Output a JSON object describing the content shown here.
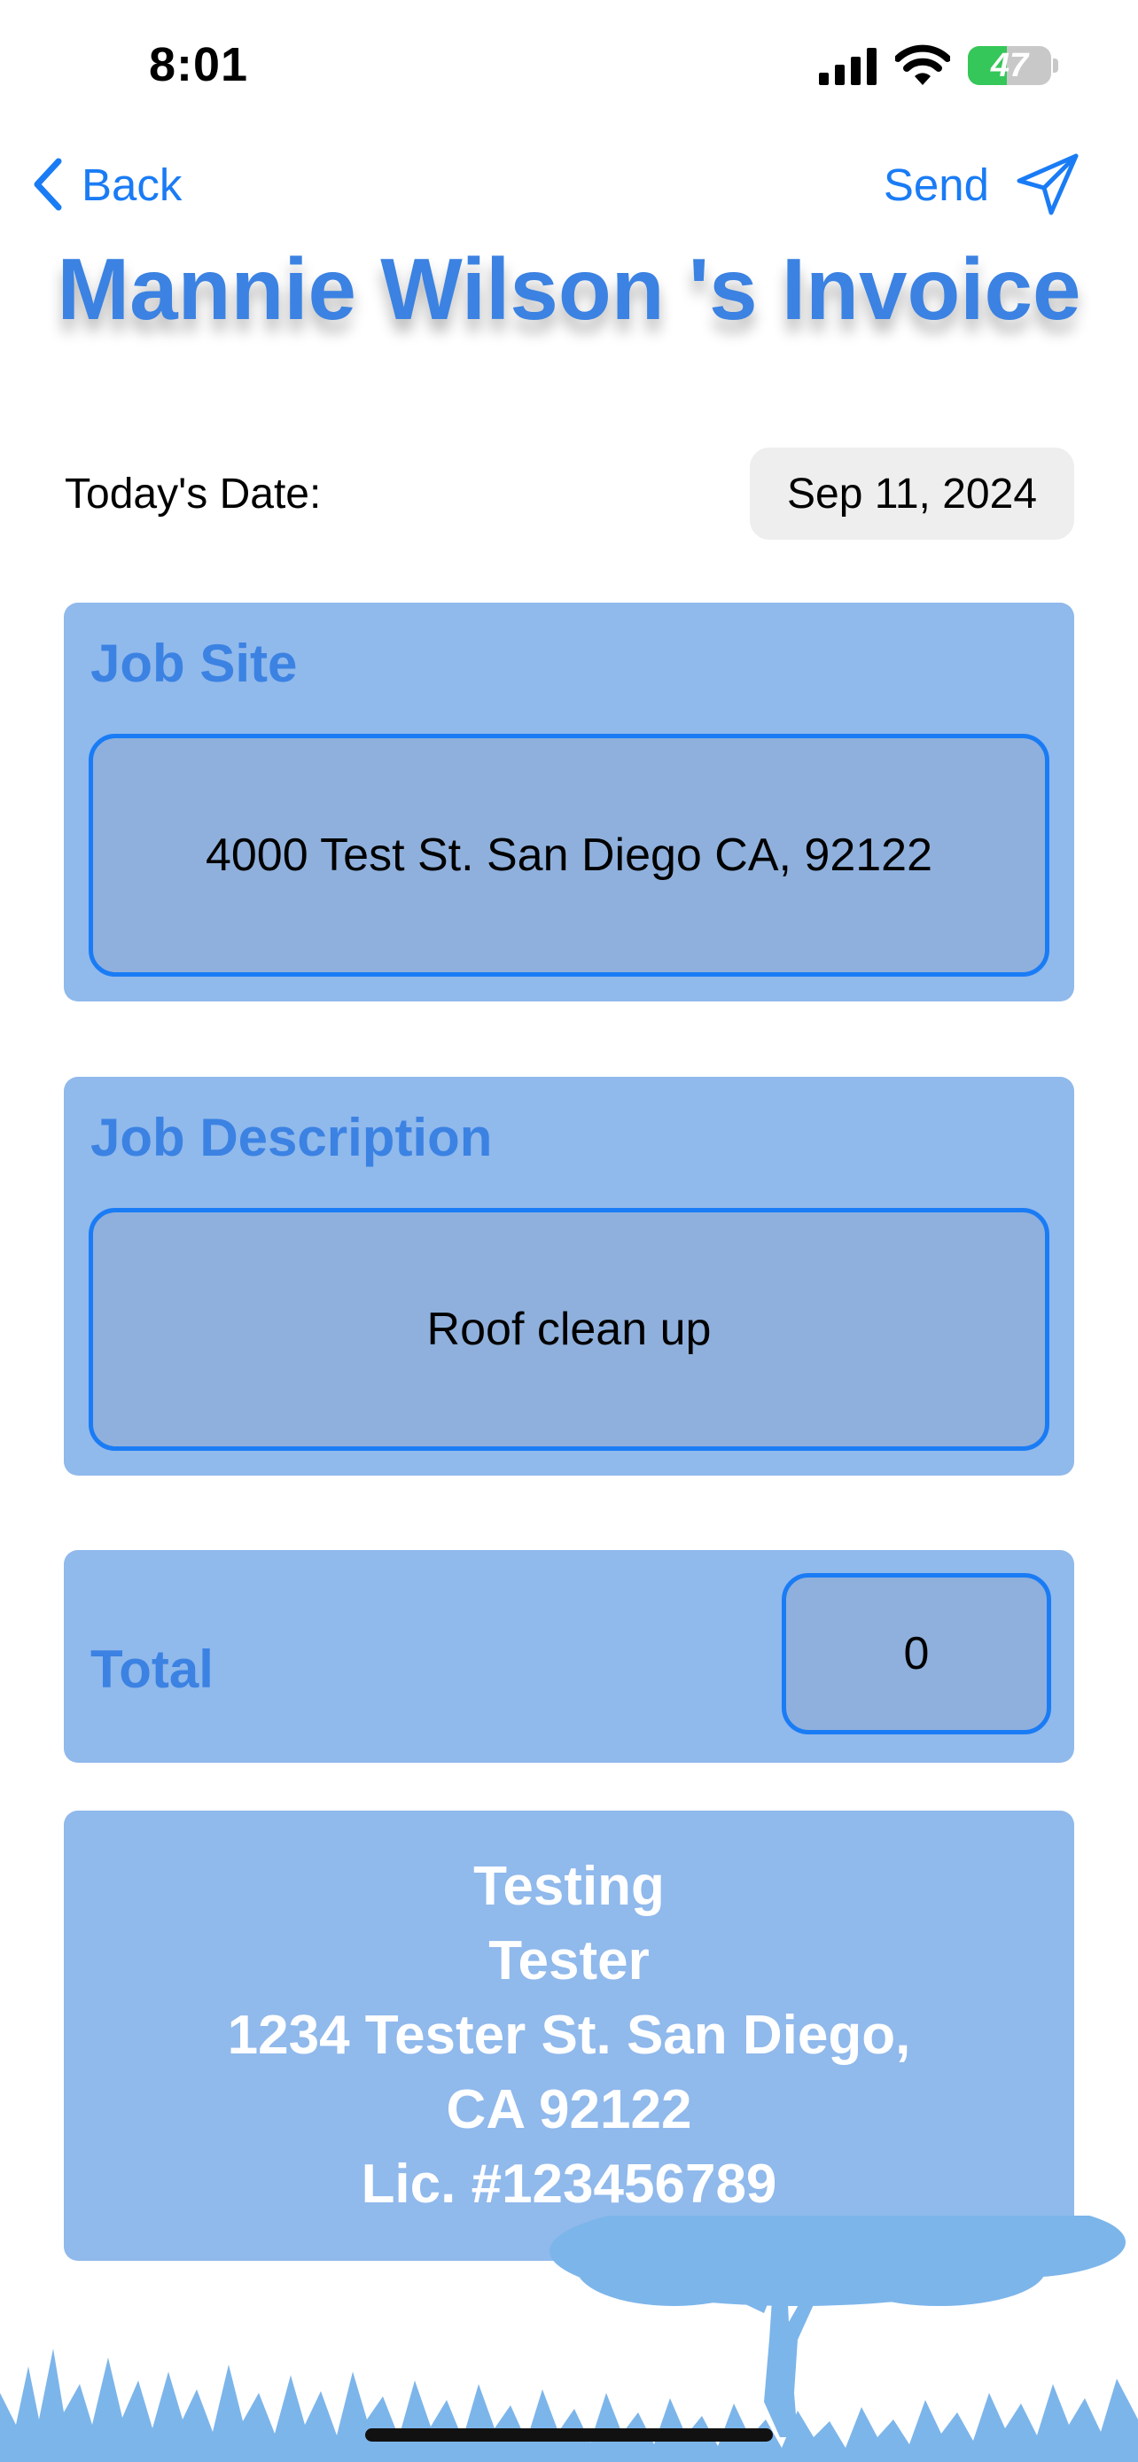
{
  "status_bar": {
    "time": "8:01",
    "battery_percent": "47",
    "battery_level": 0.47,
    "battery_charging": true,
    "icons": [
      "signal-icon",
      "wifi-icon",
      "battery-icon"
    ]
  },
  "nav": {
    "back_label": "Back",
    "send_label": "Send",
    "icons": [
      "chevron-left-icon",
      "paper-plane-icon"
    ]
  },
  "page": {
    "title": "Mannie Wilson 's Invoice"
  },
  "date_row": {
    "label": "Today's Date:",
    "value": "Sep 11, 2024"
  },
  "job_site": {
    "heading": "Job Site",
    "value": "4000 Test St. San Diego CA, 92122"
  },
  "job_description": {
    "heading": "Job Description",
    "value": "Roof clean up"
  },
  "total": {
    "label": "Total",
    "value": "0"
  },
  "contractor": {
    "lines": [
      "Testing",
      "Tester",
      "1234 Tester St. San Diego,",
      "CA 92122",
      "Lic. #123456789"
    ]
  },
  "colors": {
    "accent": "#1a7cf5",
    "title": "#3b82e2",
    "card_background": "#90b9ec",
    "field_background": "#8fb0dc",
    "battery_green": "#35c759"
  }
}
